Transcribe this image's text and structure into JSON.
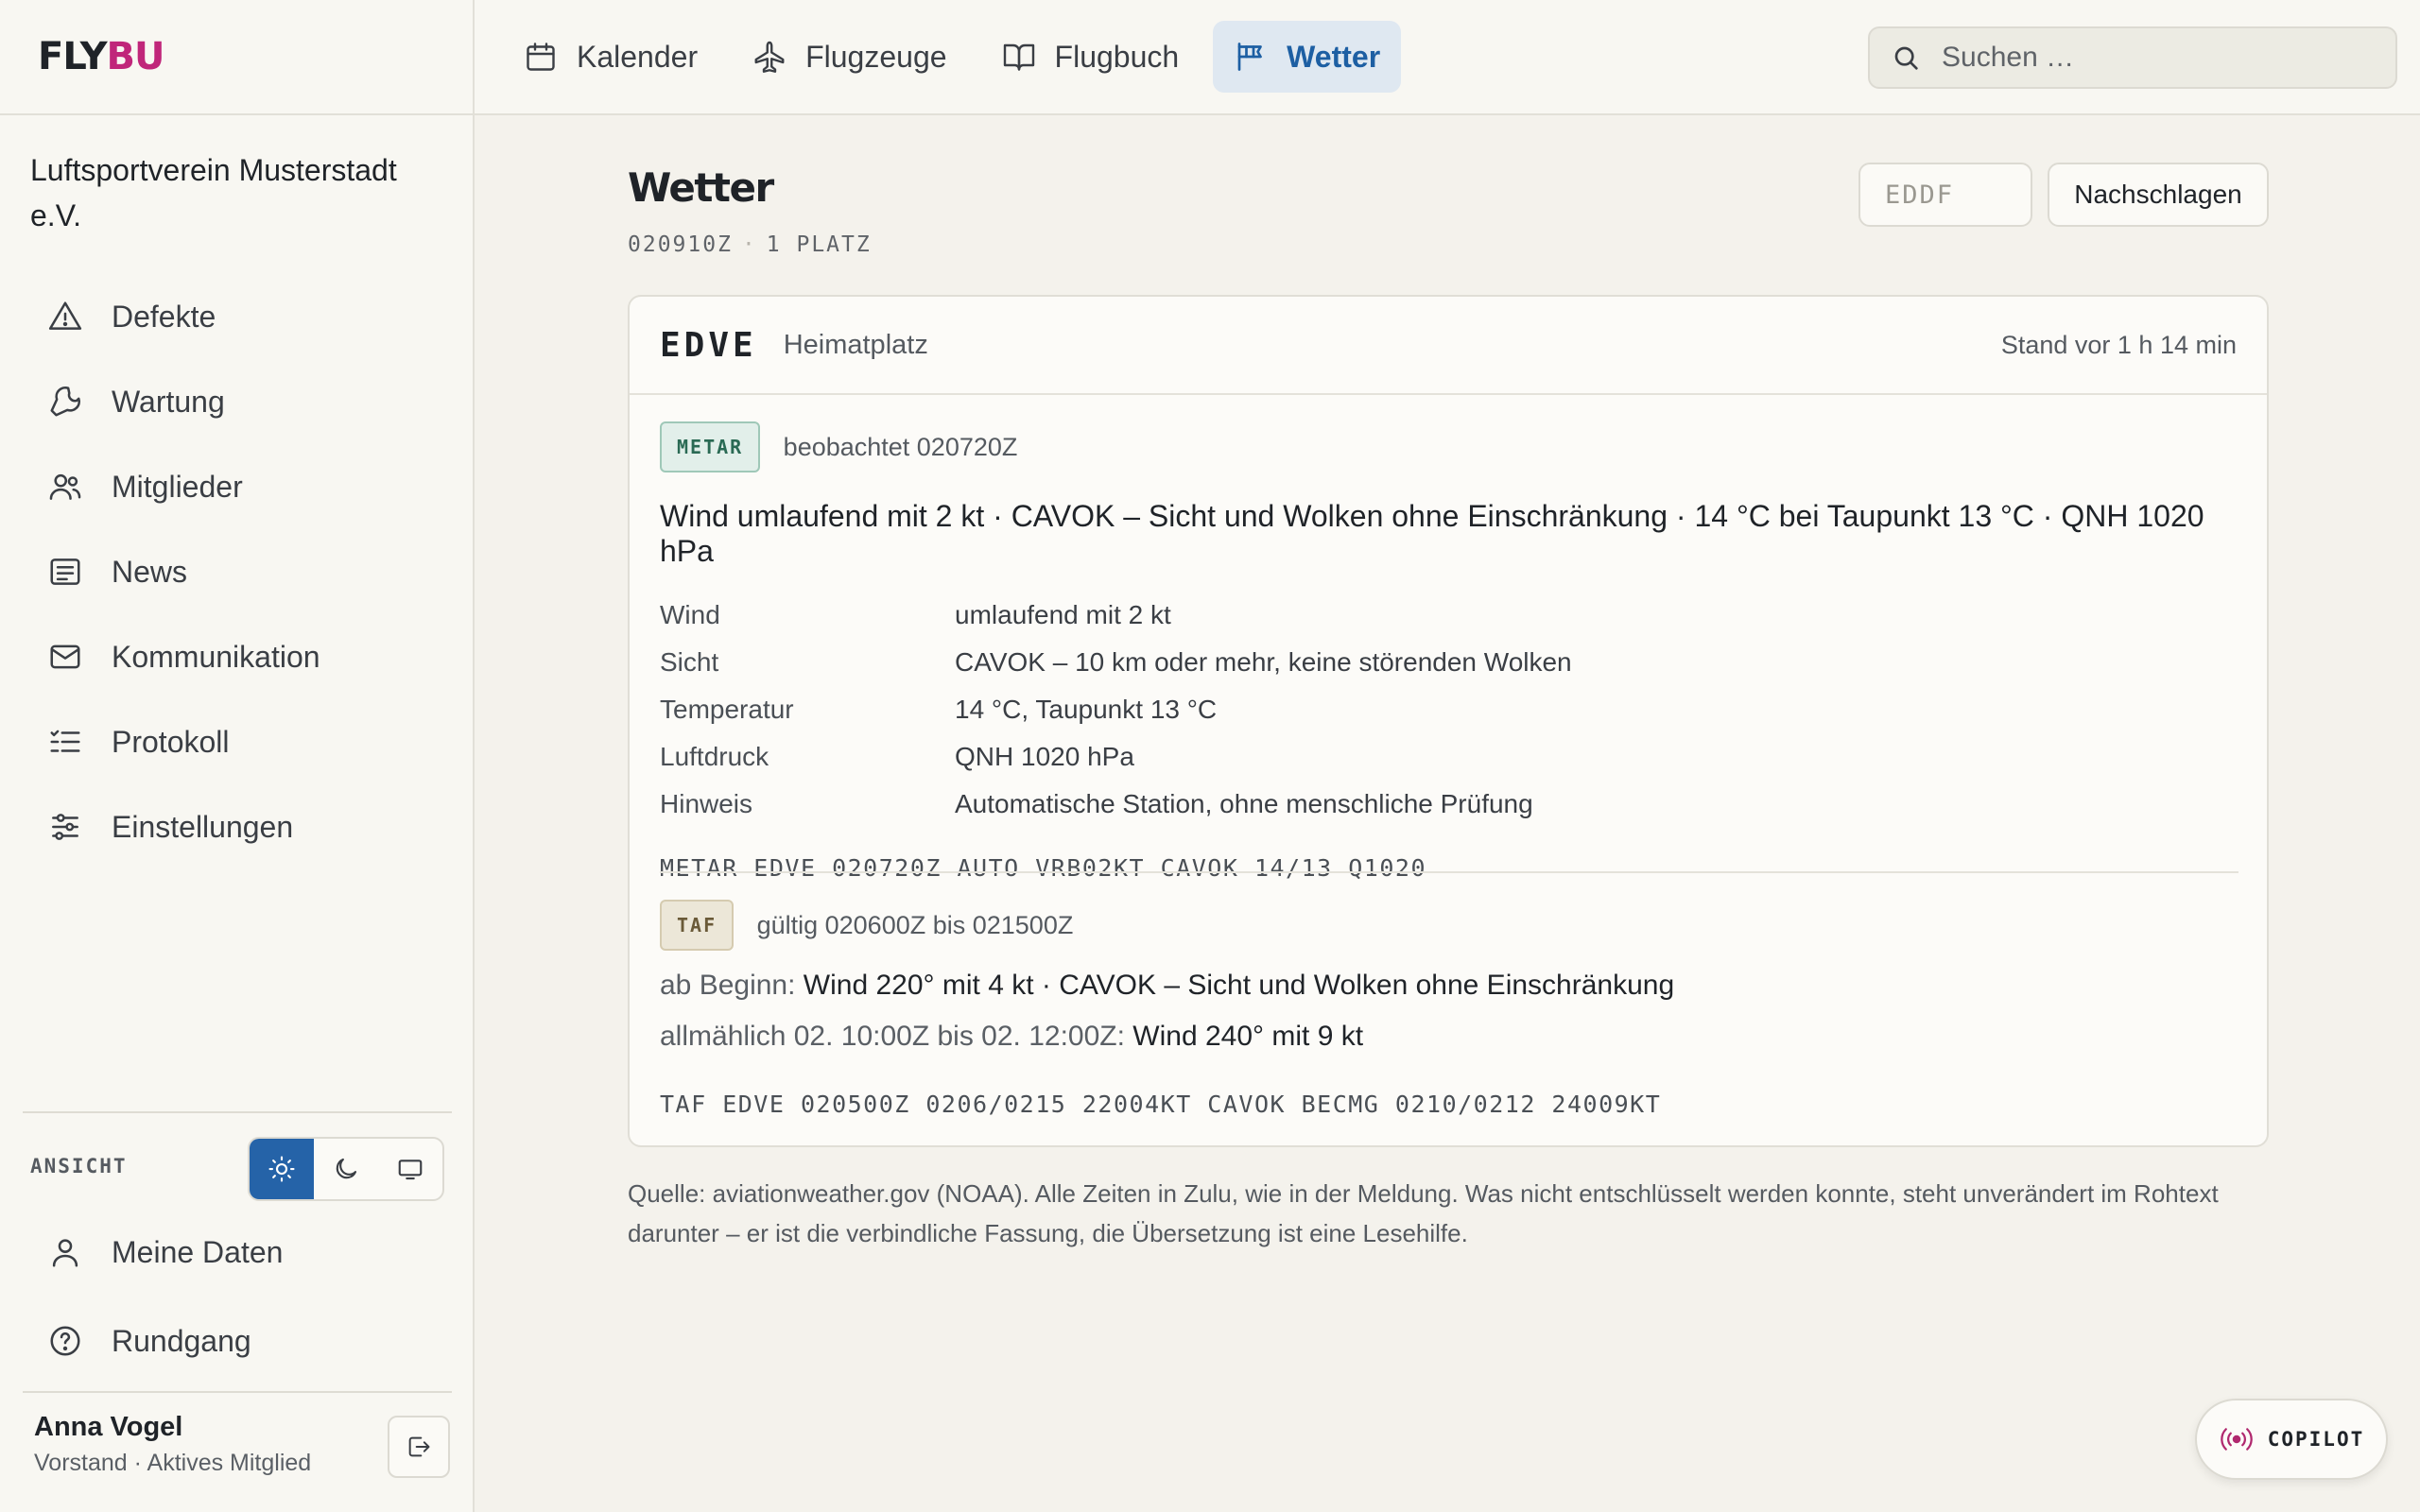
{
  "brand": {
    "part1": "FLY",
    "part2": "BU",
    "accent": "#c0267a"
  },
  "sidebar": {
    "org_name": "Luftsportverein Musterstadt e.V.",
    "items": [
      {
        "label": "Defekte",
        "icon": "warning-icon"
      },
      {
        "label": "Wartung",
        "icon": "wrench-icon"
      },
      {
        "label": "Mitglieder",
        "icon": "users-icon"
      },
      {
        "label": "News",
        "icon": "newspaper-icon"
      },
      {
        "label": "Kommunikation",
        "icon": "mail-icon"
      },
      {
        "label": "Protokoll",
        "icon": "list-icon"
      },
      {
        "label": "Einstellungen",
        "icon": "sliders-icon"
      }
    ],
    "view_label": "ANSICHT",
    "theme_options": [
      "light",
      "dark",
      "system"
    ],
    "theme_selected": "light",
    "bottom_items": [
      {
        "label": "Meine Daten",
        "icon": "user-icon"
      },
      {
        "label": "Rundgang",
        "icon": "help-icon"
      }
    ],
    "user": {
      "name": "Anna Vogel",
      "role": "Vorstand · Aktives Mitglied"
    }
  },
  "topbar": {
    "tabs": [
      {
        "label": "Kalender",
        "icon": "calendar-icon",
        "active": false
      },
      {
        "label": "Flugzeuge",
        "icon": "plane-icon",
        "active": false
      },
      {
        "label": "Flugbuch",
        "icon": "book-icon",
        "active": false
      },
      {
        "label": "Wetter",
        "icon": "flag-icon",
        "active": true
      }
    ],
    "search_placeholder": "Suchen …"
  },
  "page": {
    "title": "Wetter",
    "meta_time": "020910Z",
    "meta_count": "1 PLATZ",
    "icao_placeholder": "EDDF",
    "lookup_label": "Nachschlagen"
  },
  "station": {
    "icao": "EDVE",
    "role": "Heimatplatz",
    "stand": "Stand vor 1 h 14 min",
    "metar": {
      "badge": "METAR",
      "observed": "beobachtet 020720Z",
      "summary": "Wind umlaufend mit 2 kt · CAVOK – Sicht und Wolken ohne Einschränkung · 14 °C bei Taupunkt 13 °C · QNH 1020 hPa",
      "rows": [
        {
          "k": "Wind",
          "v": "umlaufend mit 2 kt"
        },
        {
          "k": "Sicht",
          "v": "CAVOK – 10 km oder mehr, keine störenden Wolken"
        },
        {
          "k": "Temperatur",
          "v": "14 °C, Taupunkt 13 °C"
        },
        {
          "k": "Luftdruck",
          "v": "QNH 1020 hPa"
        },
        {
          "k": "Hinweis",
          "v": "Automatische Station, ohne menschliche Prüfung"
        }
      ],
      "raw": "METAR EDVE 020720Z AUTO VRB02KT CAVOK 14/13 Q1020"
    },
    "taf": {
      "badge": "TAF",
      "valid": "gültig 020600Z bis 021500Z",
      "lines": [
        {
          "label": "ab Beginn:",
          "text": "Wind 220° mit 4 kt · CAVOK – Sicht und Wolken ohne Einschränkung"
        },
        {
          "label": "allmählich 02. 10:00Z bis 02. 12:00Z:",
          "text": "Wind 240° mit 9 kt"
        }
      ],
      "raw": "TAF EDVE 020500Z 0206/0215 22004KT CAVOK BECMG 0210/0212 24009KT"
    }
  },
  "source_note": "Quelle: aviationweather.gov (NOAA). Alle Zeiten in Zulu, wie in der Meldung. Was nicht entschlüsselt werden konnte, steht unverändert im Rohtext darunter – er ist die verbindliche Fassung, die Übersetzung ist eine Lesehilfe.",
  "copilot_label": "COPILOT",
  "colors": {
    "primary": "#2563a8",
    "active_tab_bg": "#dfe8f1",
    "background": "#f4f2ec"
  }
}
